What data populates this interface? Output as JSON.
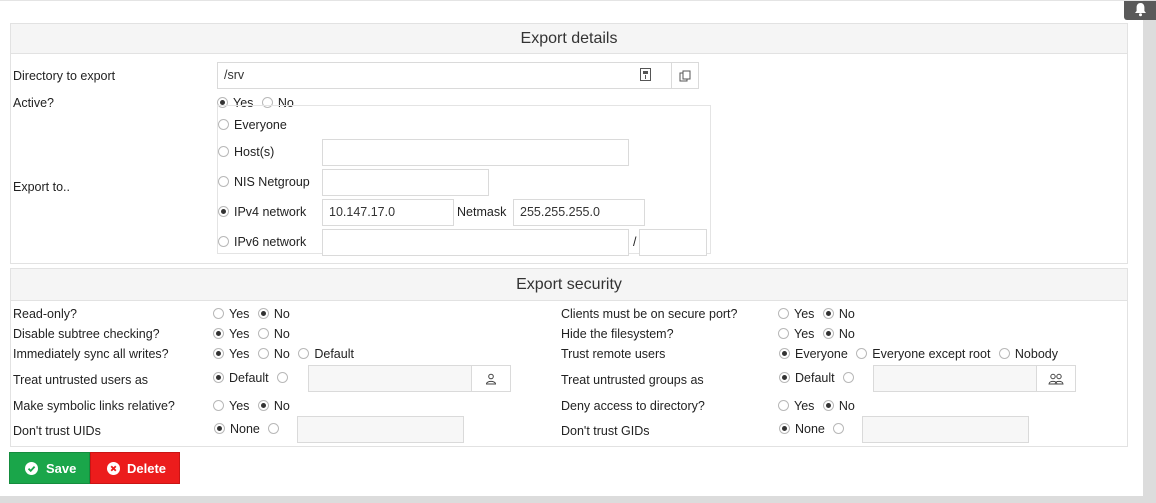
{
  "panel1": {
    "title": "Export details",
    "dir_label": "Directory to export",
    "dir_value": "/srv",
    "active_label": "Active?",
    "active_yes": "Yes",
    "active_no": "No",
    "export_to_label": "Export to..",
    "opt_everyone": "Everyone",
    "opt_hosts": "Host(s)",
    "opt_nis": "NIS Netgroup",
    "opt_ipv4": "IPv4 network",
    "ipv4_value": "10.147.17.0",
    "netmask_label": "Netmask",
    "netmask_value": "255.255.255.0",
    "opt_ipv6": "IPv6 network",
    "slash": "/"
  },
  "panel2": {
    "title": "Export security",
    "readonly_label": "Read-only?",
    "subtree_label": "Disable subtree checking?",
    "sync_label": "Immediately sync all writes?",
    "untrusted_users_label": "Treat untrusted users as",
    "symlinks_label": "Make symbolic links relative?",
    "uids_label": "Don't trust UIDs",
    "secure_port_label": "Clients must be on secure port?",
    "hide_fs_label": "Hide the filesystem?",
    "trust_remote_label": "Trust remote users",
    "untrusted_groups_label": "Treat untrusted groups as",
    "deny_label": "Deny access to directory?",
    "gids_label": "Don't trust GIDs",
    "yes": "Yes",
    "no": "No",
    "default": "Default",
    "everyone": "Everyone",
    "everyone_except_root": "Everyone except root",
    "nobody": "Nobody",
    "none": "None"
  },
  "actions": {
    "save_label": "Save",
    "delete_label": "Delete"
  },
  "colors": {
    "save": "#1aa64a",
    "delete": "#ec1c1c"
  }
}
